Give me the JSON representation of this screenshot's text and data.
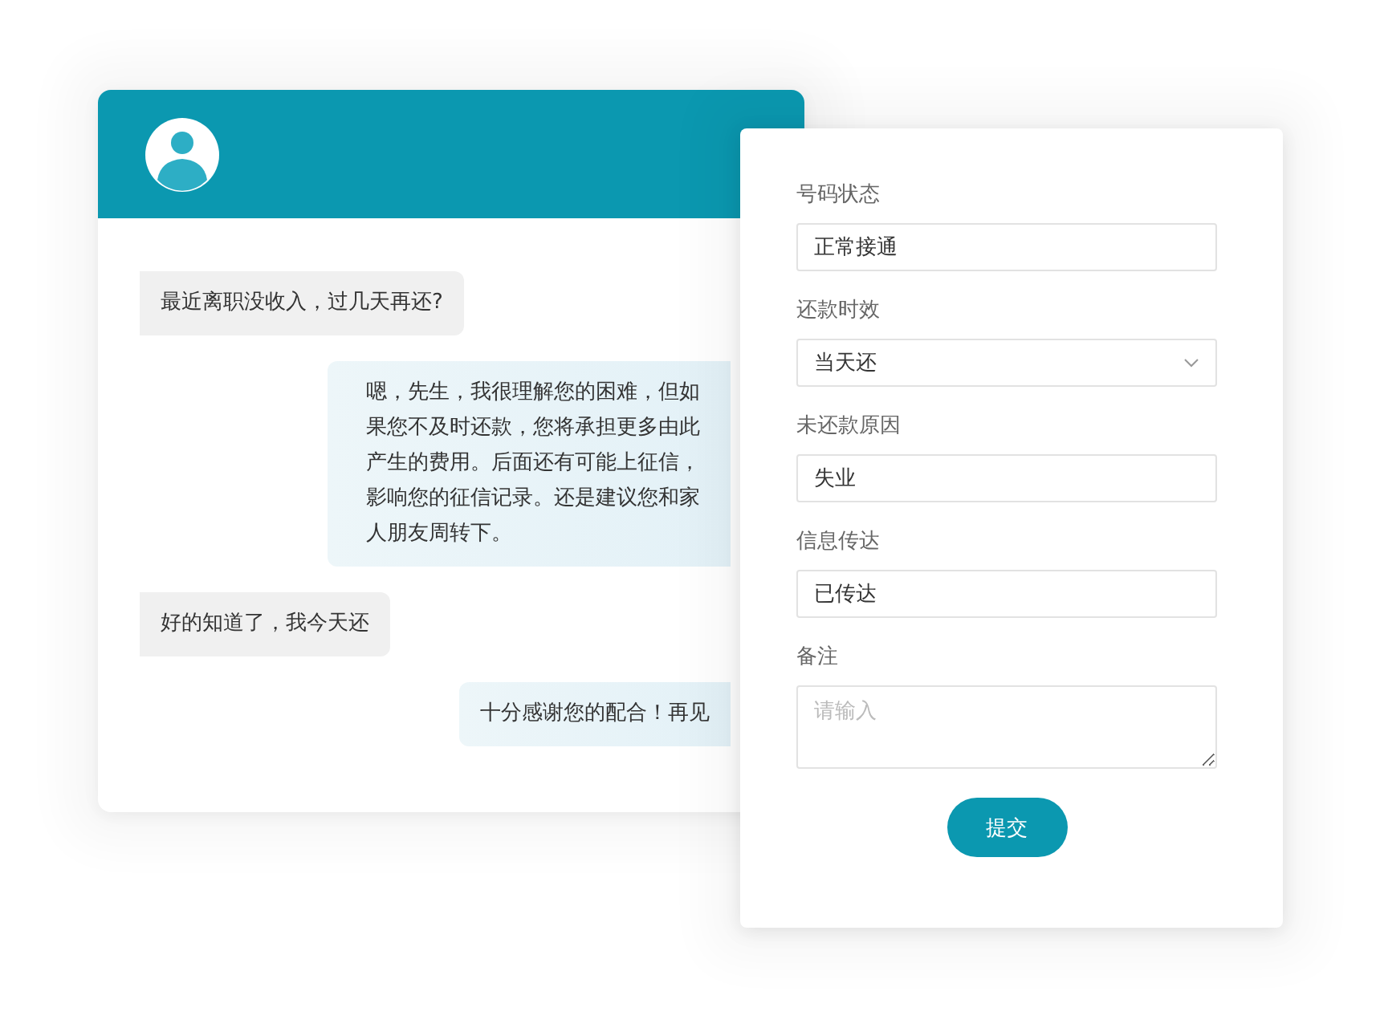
{
  "chat": {
    "messages": [
      {
        "kind": "received",
        "text": "最近离职没收入，过几天再还?"
      },
      {
        "kind": "sent",
        "text": "嗯，先生，我很理解您的困难，但如果您不及时还款，您将承担更多由此产生的费用。后面还有可能上征信，影响您的征信记录。还是建议您和家人朋友周转下。"
      },
      {
        "kind": "received",
        "text": "好的知道了，我今天还"
      },
      {
        "kind": "sent",
        "text": "十分感谢您的配合！再见"
      }
    ]
  },
  "form": {
    "fields": [
      {
        "kind": "text",
        "label": "号码状态",
        "value": "正常接通"
      },
      {
        "kind": "select",
        "label": "还款时效",
        "value": "当天还"
      },
      {
        "kind": "text",
        "label": "未还款原因",
        "value": "失业"
      },
      {
        "kind": "text",
        "label": "信息传达",
        "value": "已传达"
      },
      {
        "kind": "textarea",
        "label": "备注",
        "placeholder": "请输入"
      }
    ],
    "submit": "提交"
  }
}
